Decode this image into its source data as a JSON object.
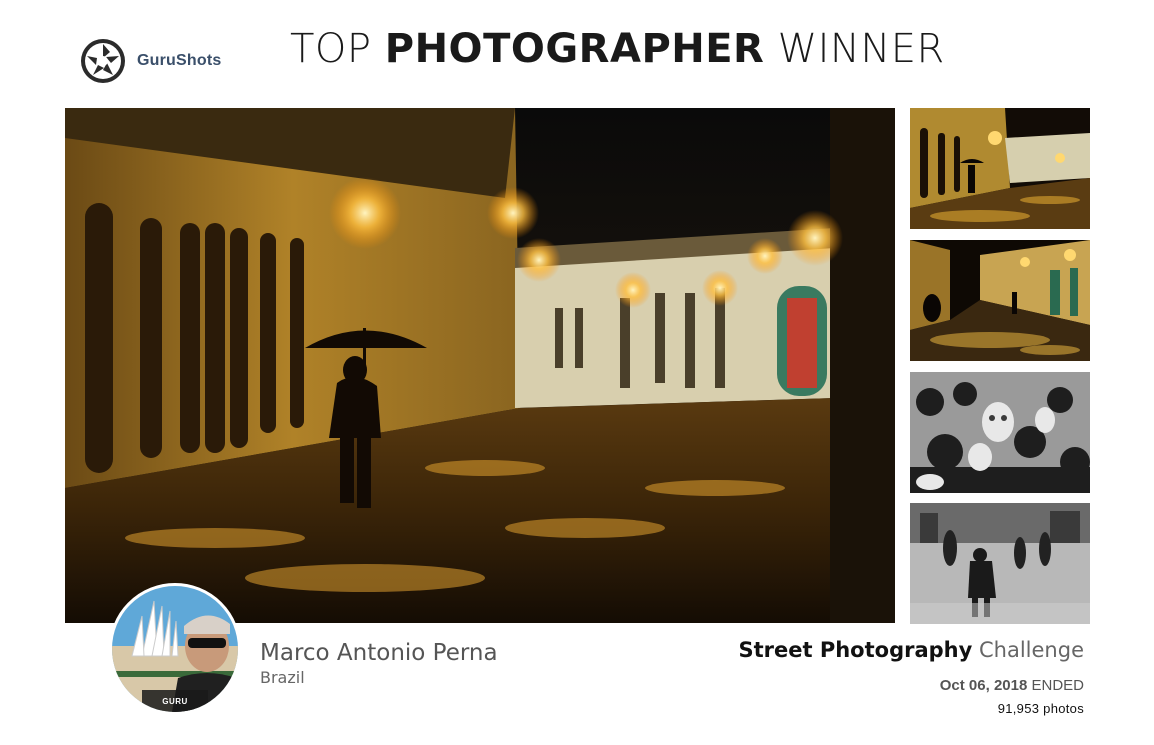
{
  "brand": {
    "logo_icon": "aperture-logo-icon",
    "name": "GuruShots"
  },
  "headline": {
    "prefix": "TOP",
    "emphasis": "PHOTOGRAPHER",
    "suffix": "WINNER"
  },
  "winner": {
    "name": "Marco Antonio Perna",
    "country": "Brazil",
    "badge": "GURU"
  },
  "challenge": {
    "title_bold": "Street Photography",
    "title_light": "Challenge",
    "date": "Oct 06, 2018",
    "status": "ENDED",
    "photo_count": "91,953 photos"
  },
  "colors": {
    "accent_gold": "#f0b030",
    "night_dark": "#1a1208",
    "logo_blue": "#3a4f6a"
  }
}
